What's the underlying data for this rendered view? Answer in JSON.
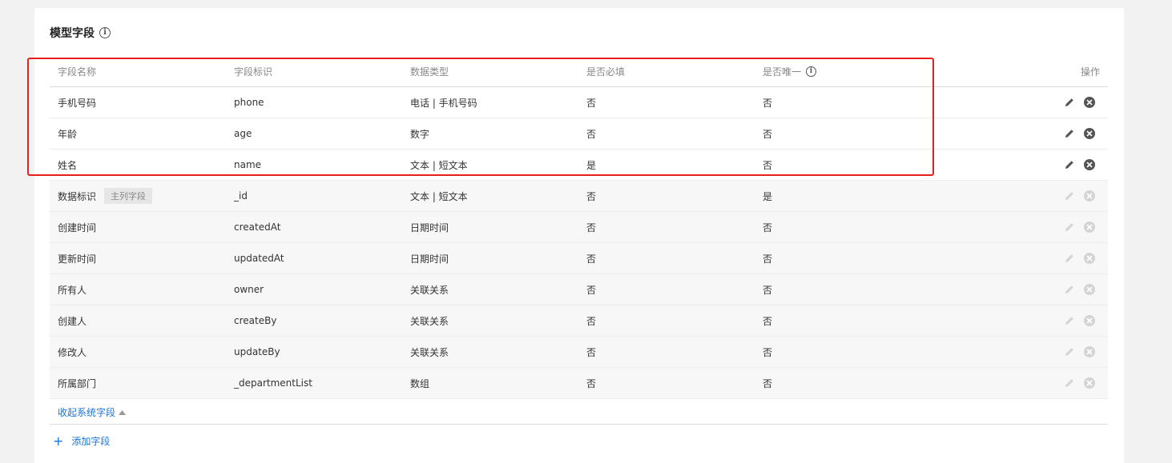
{
  "section": {
    "title": "模型字段"
  },
  "table": {
    "headers": [
      "字段名称",
      "字段标识",
      "数据类型",
      "是否必填",
      "是否唯一",
      "操作"
    ],
    "user_rows": [
      {
        "name": "手机号码",
        "key": "phone",
        "type": "电话 | 手机号码",
        "required": "否",
        "unique": "否"
      },
      {
        "name": "年龄",
        "key": "age",
        "type": "数字",
        "required": "否",
        "unique": "否"
      },
      {
        "name": "姓名",
        "key": "name",
        "type": "文本 | 短文本",
        "required": "是",
        "unique": "否"
      }
    ],
    "system_rows": [
      {
        "name": "数据标识",
        "tag": "主列字段",
        "key": "_id",
        "type": "文本 | 短文本",
        "required": "否",
        "unique": "是"
      },
      {
        "name": "创建时间",
        "key": "createdAt",
        "type": "日期时间",
        "required": "否",
        "unique": "否"
      },
      {
        "name": "更新时间",
        "key": "updatedAt",
        "type": "日期时间",
        "required": "否",
        "unique": "否"
      },
      {
        "name": "所有人",
        "key": "owner",
        "type": "关联关系",
        "required": "否",
        "unique": "否"
      },
      {
        "name": "创建人",
        "key": "createBy",
        "type": "关联关系",
        "required": "否",
        "unique": "否"
      },
      {
        "name": "修改人",
        "key": "updateBy",
        "type": "关联关系",
        "required": "否",
        "unique": "否"
      },
      {
        "name": "所属部门",
        "key": "_departmentList",
        "type": "数组",
        "required": "否",
        "unique": "否"
      }
    ]
  },
  "actions": {
    "collapse_label": "收起系统字段",
    "add_label": "添加字段"
  },
  "icons": {
    "info": "info-icon",
    "edit": "pencil-icon",
    "delete": "close-circle-icon",
    "collapse": "caret-up-icon",
    "add": "plus-icon"
  },
  "colors": {
    "link": "#1a73d9",
    "highlight": "#e8201d",
    "system_row_bg": "#f7f7f7"
  }
}
